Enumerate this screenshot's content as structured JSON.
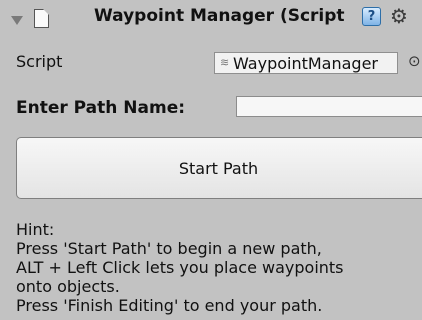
{
  "header": {
    "foldout_icon": "triangle-down-icon",
    "component_icon": "script-file-icon",
    "title": "Waypoint Manager (Script",
    "help_icon": "help-icon",
    "gear_icon": "gear-icon"
  },
  "script_row": {
    "label": "Script",
    "value": "WaypointManager",
    "picker_icon": "object-picker-icon"
  },
  "path_row": {
    "label": "Enter Path Name:",
    "value": ""
  },
  "start_button": {
    "label": "Start Path"
  },
  "hint": {
    "title": "Hint:",
    "lines": [
      "Press 'Start Path' to begin a new path,",
      "ALT + Left Click lets you place waypoints",
      "onto objects.",
      "Press 'Finish Editing' to end your path."
    ]
  }
}
